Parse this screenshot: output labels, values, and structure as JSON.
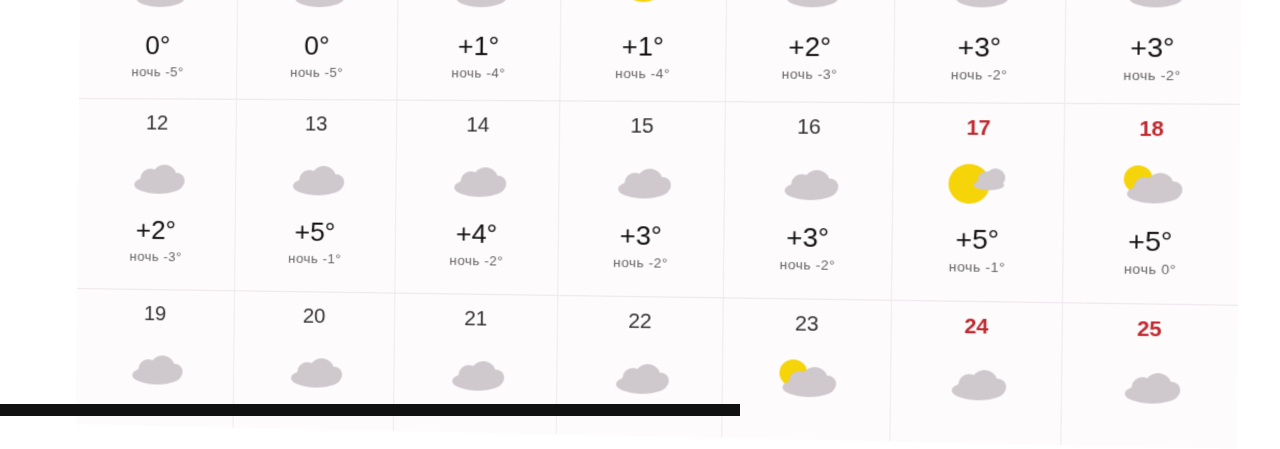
{
  "calendar": {
    "night_prefix": "ночь",
    "rows": [
      {
        "cells": [
          {
            "date": "",
            "weekend": false,
            "icon": "cloud-icon",
            "temp": "0°",
            "night": "ночь -5°"
          },
          {
            "date": "",
            "weekend": false,
            "icon": "cloud-icon",
            "temp": "0°",
            "night": "ночь -5°"
          },
          {
            "date": "",
            "weekend": false,
            "icon": "cloud-icon",
            "temp": "+1°",
            "night": "ночь -4°"
          },
          {
            "date": "",
            "weekend": false,
            "icon": "sun-icon",
            "temp": "+1°",
            "night": "ночь -4°"
          },
          {
            "date": "",
            "weekend": false,
            "icon": "cloud-icon",
            "temp": "+2°",
            "night": "ночь -3°"
          },
          {
            "date": "",
            "weekend": false,
            "icon": "cloud-icon",
            "temp": "+3°",
            "night": "ночь -2°"
          },
          {
            "date": "",
            "weekend": false,
            "icon": "cloud-icon",
            "temp": "+3°",
            "night": "ночь -2°"
          }
        ]
      },
      {
        "cells": [
          {
            "date": "12",
            "weekend": false,
            "icon": "cloud-icon",
            "temp": "+2°",
            "night": "ночь -3°"
          },
          {
            "date": "13",
            "weekend": false,
            "icon": "cloud-icon",
            "temp": "+5°",
            "night": "ночь -1°"
          },
          {
            "date": "14",
            "weekend": false,
            "icon": "cloud-icon",
            "temp": "+4°",
            "night": "ночь -2°"
          },
          {
            "date": "15",
            "weekend": false,
            "icon": "cloud-icon",
            "temp": "+3°",
            "night": "ночь -2°"
          },
          {
            "date": "16",
            "weekend": false,
            "icon": "cloud-icon",
            "temp": "+3°",
            "night": "ночь -2°"
          },
          {
            "date": "17",
            "weekend": true,
            "icon": "sun-cloud-icon",
            "temp": "+5°",
            "night": "ночь -1°"
          },
          {
            "date": "18",
            "weekend": true,
            "icon": "partly-cloudy-icon",
            "temp": "+5°",
            "night": "ночь 0°"
          }
        ]
      },
      {
        "cells": [
          {
            "date": "19",
            "weekend": false,
            "icon": "cloud-icon"
          },
          {
            "date": "20",
            "weekend": false,
            "icon": "cloud-icon"
          },
          {
            "date": "21",
            "weekend": false,
            "icon": "cloud-icon"
          },
          {
            "date": "22",
            "weekend": false,
            "icon": "cloud-icon"
          },
          {
            "date": "23",
            "weekend": false,
            "icon": "partly-cloudy-icon"
          },
          {
            "date": "24",
            "weekend": true,
            "icon": "cloud-icon"
          },
          {
            "date": "25",
            "weekend": true,
            "icon": "cloud-icon"
          }
        ]
      }
    ]
  },
  "colors": {
    "weekend": "#c0282e",
    "cloud": "#cfc8cc",
    "sun": "#f5d40a"
  }
}
